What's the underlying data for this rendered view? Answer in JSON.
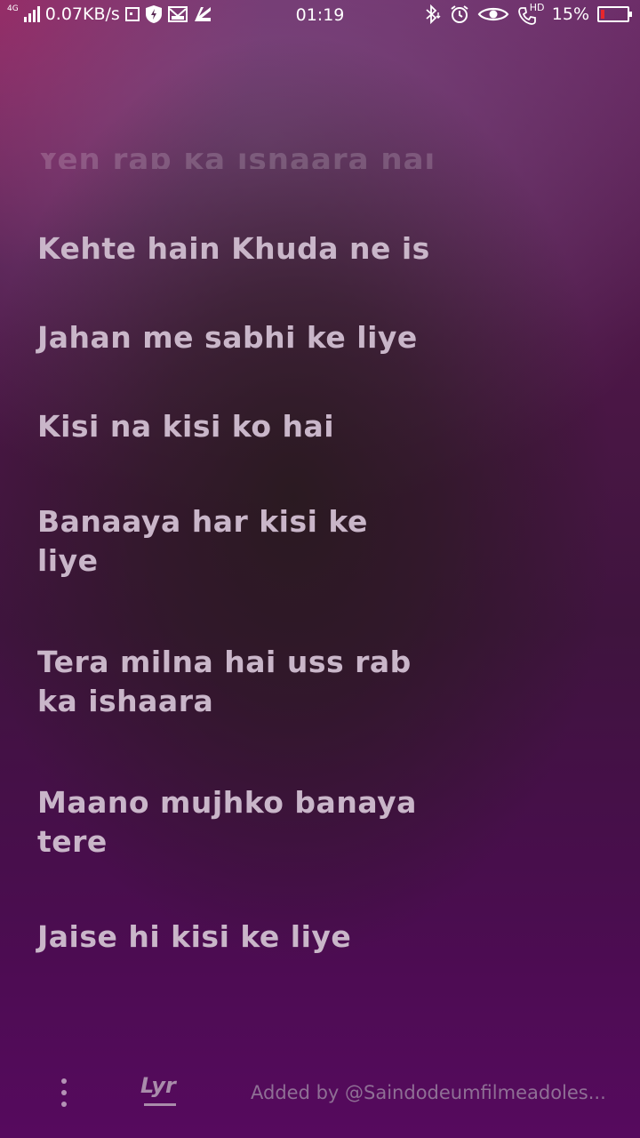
{
  "status_bar": {
    "network_type": "4G",
    "speed": "0.07KB/s",
    "time": "01:19",
    "hd_label": "HD",
    "battery_percent": "15%",
    "battery_level": 0.15,
    "battery_color": "#e8262c",
    "icons": [
      "signal-icon",
      "notification-box-icon",
      "shield-icon",
      "mail-icon",
      "app-icon",
      "bluetooth-icon",
      "alarm-icon",
      "eye-icon",
      "phone-hd-icon",
      "battery-icon"
    ]
  },
  "lyrics": {
    "faded_line": "Yeh rab ka ishaara hai",
    "lines": [
      "Kehte hain Khuda ne is",
      "Jahan me sabhi ke liye",
      "Kisi na kisi ko hai",
      "Banaaya har kisi ke liye",
      "Tera milna hai uss rab ka ishaara",
      "Maano mujhko banaya tere",
      "Jaise hi kisi ke liye"
    ]
  },
  "bottom_bar": {
    "logo_text": "Lyr",
    "added_by": "Added by @Saindodeumfilmeadoles..."
  }
}
